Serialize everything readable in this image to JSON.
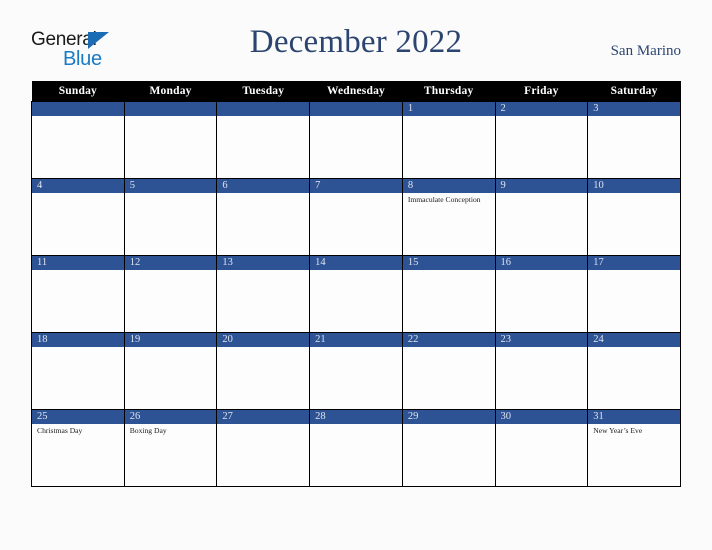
{
  "brand": {
    "name_part1": "General",
    "name_part2": "Blue"
  },
  "header": {
    "title": "December 2022",
    "region": "San Marino"
  },
  "colors": {
    "header_bar": "#000000",
    "date_bar": "#2e5395",
    "title": "#2c4570",
    "logo_blue": "#1b7ac4",
    "page_bg": "#fbfbfb"
  },
  "calendar": {
    "weekday_headers": [
      "Sunday",
      "Monday",
      "Tuesday",
      "Wednesday",
      "Thursday",
      "Friday",
      "Saturday"
    ],
    "weeks": [
      [
        {
          "day": "",
          "events": []
        },
        {
          "day": "",
          "events": []
        },
        {
          "day": "",
          "events": []
        },
        {
          "day": "",
          "events": []
        },
        {
          "day": "1",
          "events": []
        },
        {
          "day": "2",
          "events": []
        },
        {
          "day": "3",
          "events": []
        }
      ],
      [
        {
          "day": "4",
          "events": []
        },
        {
          "day": "5",
          "events": []
        },
        {
          "day": "6",
          "events": []
        },
        {
          "day": "7",
          "events": []
        },
        {
          "day": "8",
          "events": [
            "Immaculate Conception"
          ]
        },
        {
          "day": "9",
          "events": []
        },
        {
          "day": "10",
          "events": []
        }
      ],
      [
        {
          "day": "11",
          "events": []
        },
        {
          "day": "12",
          "events": []
        },
        {
          "day": "13",
          "events": []
        },
        {
          "day": "14",
          "events": []
        },
        {
          "day": "15",
          "events": []
        },
        {
          "day": "16",
          "events": []
        },
        {
          "day": "17",
          "events": []
        }
      ],
      [
        {
          "day": "18",
          "events": []
        },
        {
          "day": "19",
          "events": []
        },
        {
          "day": "20",
          "events": []
        },
        {
          "day": "21",
          "events": []
        },
        {
          "day": "22",
          "events": []
        },
        {
          "day": "23",
          "events": []
        },
        {
          "day": "24",
          "events": []
        }
      ],
      [
        {
          "day": "25",
          "events": [
            "Christmas Day"
          ]
        },
        {
          "day": "26",
          "events": [
            "Boxing Day"
          ]
        },
        {
          "day": "27",
          "events": []
        },
        {
          "day": "28",
          "events": []
        },
        {
          "day": "29",
          "events": []
        },
        {
          "day": "30",
          "events": []
        },
        {
          "day": "31",
          "events": [
            "New Year’s Eve"
          ]
        }
      ]
    ]
  }
}
